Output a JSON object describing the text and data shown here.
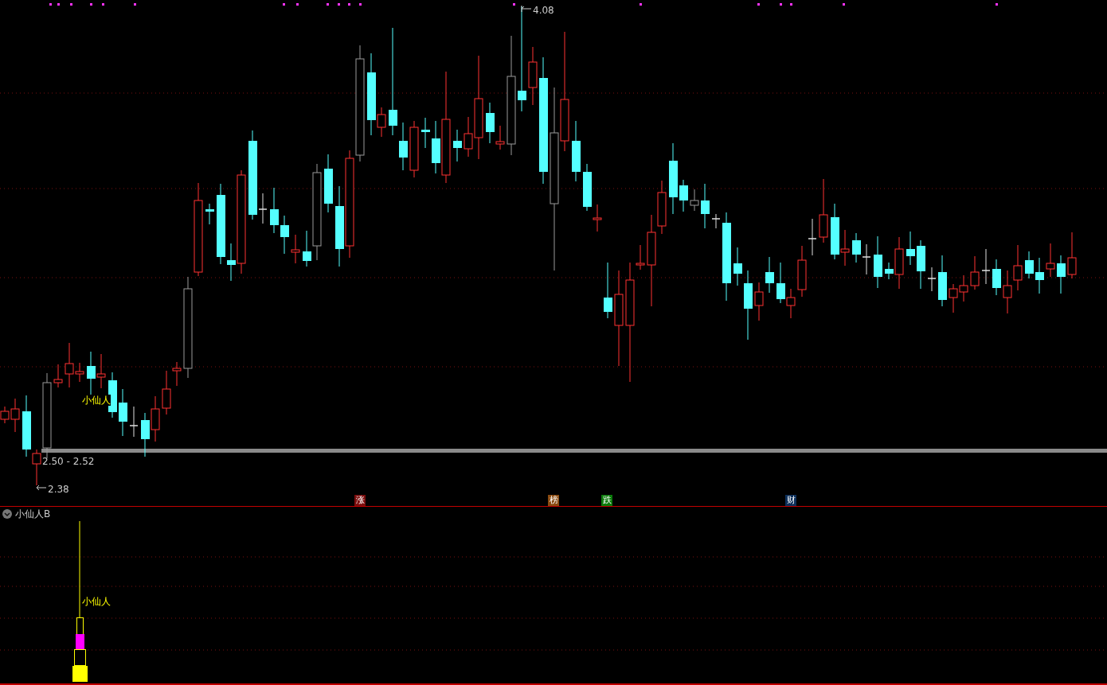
{
  "main_chart": {
    "high_label": "4.08",
    "low_label": "2.38",
    "range_label": "2.50 - 2.52",
    "signal_label": "小仙人",
    "badges": [
      {
        "text": "涨",
        "color": "#7a0c0c"
      },
      {
        "text": "榜",
        "color": "#8a4a10"
      },
      {
        "text": "跌",
        "color": "#0a7a0a"
      },
      {
        "text": "财",
        "color": "#0c2f5a"
      }
    ]
  },
  "indicator_panel": {
    "title": "小仙人B",
    "expanded": true,
    "signal_label": "小仙人"
  }
}
